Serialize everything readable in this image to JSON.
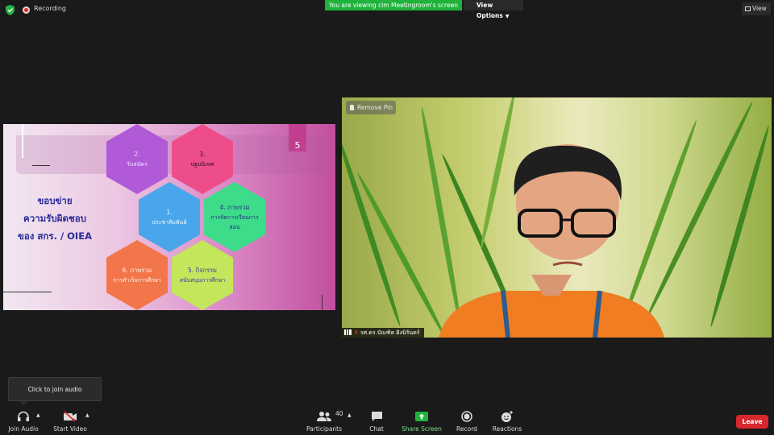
{
  "topbar": {
    "recording_label": "Recording",
    "viewing_banner": "You are viewing cim Meetingroom's screen",
    "view_options_label": "View Options",
    "view_button_label": "View"
  },
  "shared_slide": {
    "page_number": "5",
    "title_lines": [
      "ขอบข่าย",
      "ความรับผิดชอบ",
      "ของ สกร. / OIEA"
    ],
    "hexagons": [
      {
        "number": "2.",
        "text": "รับสมัคร",
        "color": "#b05ad8"
      },
      {
        "number": "3.",
        "text": "ปฐมนิเทศ",
        "color": "#ee4d8c"
      },
      {
        "number": "1.",
        "text": "ประชาสัมพันธ์",
        "color": "#4aa6ea"
      },
      {
        "number": "4. ภาพรวม",
        "text": "การจัดการเรียนการสอน",
        "color": "#3ddc8a"
      },
      {
        "number": "6. ภาพรวม",
        "text": "การสำเร็จการศึกษา",
        "color": "#f2764a"
      },
      {
        "number": "5. กิจกรรม",
        "text": "สนับสนุนการศึกษา",
        "color": "#c3e65a"
      }
    ]
  },
  "video": {
    "remove_pin_label": "Remove Pin",
    "participant_name": "รศ.ดร.บัณฑิต ฝังนิรันดร์"
  },
  "tooltip": {
    "text": "Click to join audio"
  },
  "toolbar": {
    "join_audio_label": "Join Audio",
    "start_video_label": "Start Video",
    "participants_label": "Participants",
    "participants_count": "40",
    "chat_label": "Chat",
    "share_screen_label": "Share Screen",
    "record_label": "Record",
    "reactions_label": "Reactions",
    "leave_label": "Leave"
  },
  "colors": {
    "banner_green": "#1fb33b",
    "leave_red": "#d9272e",
    "share_green": "#1fb33b"
  }
}
